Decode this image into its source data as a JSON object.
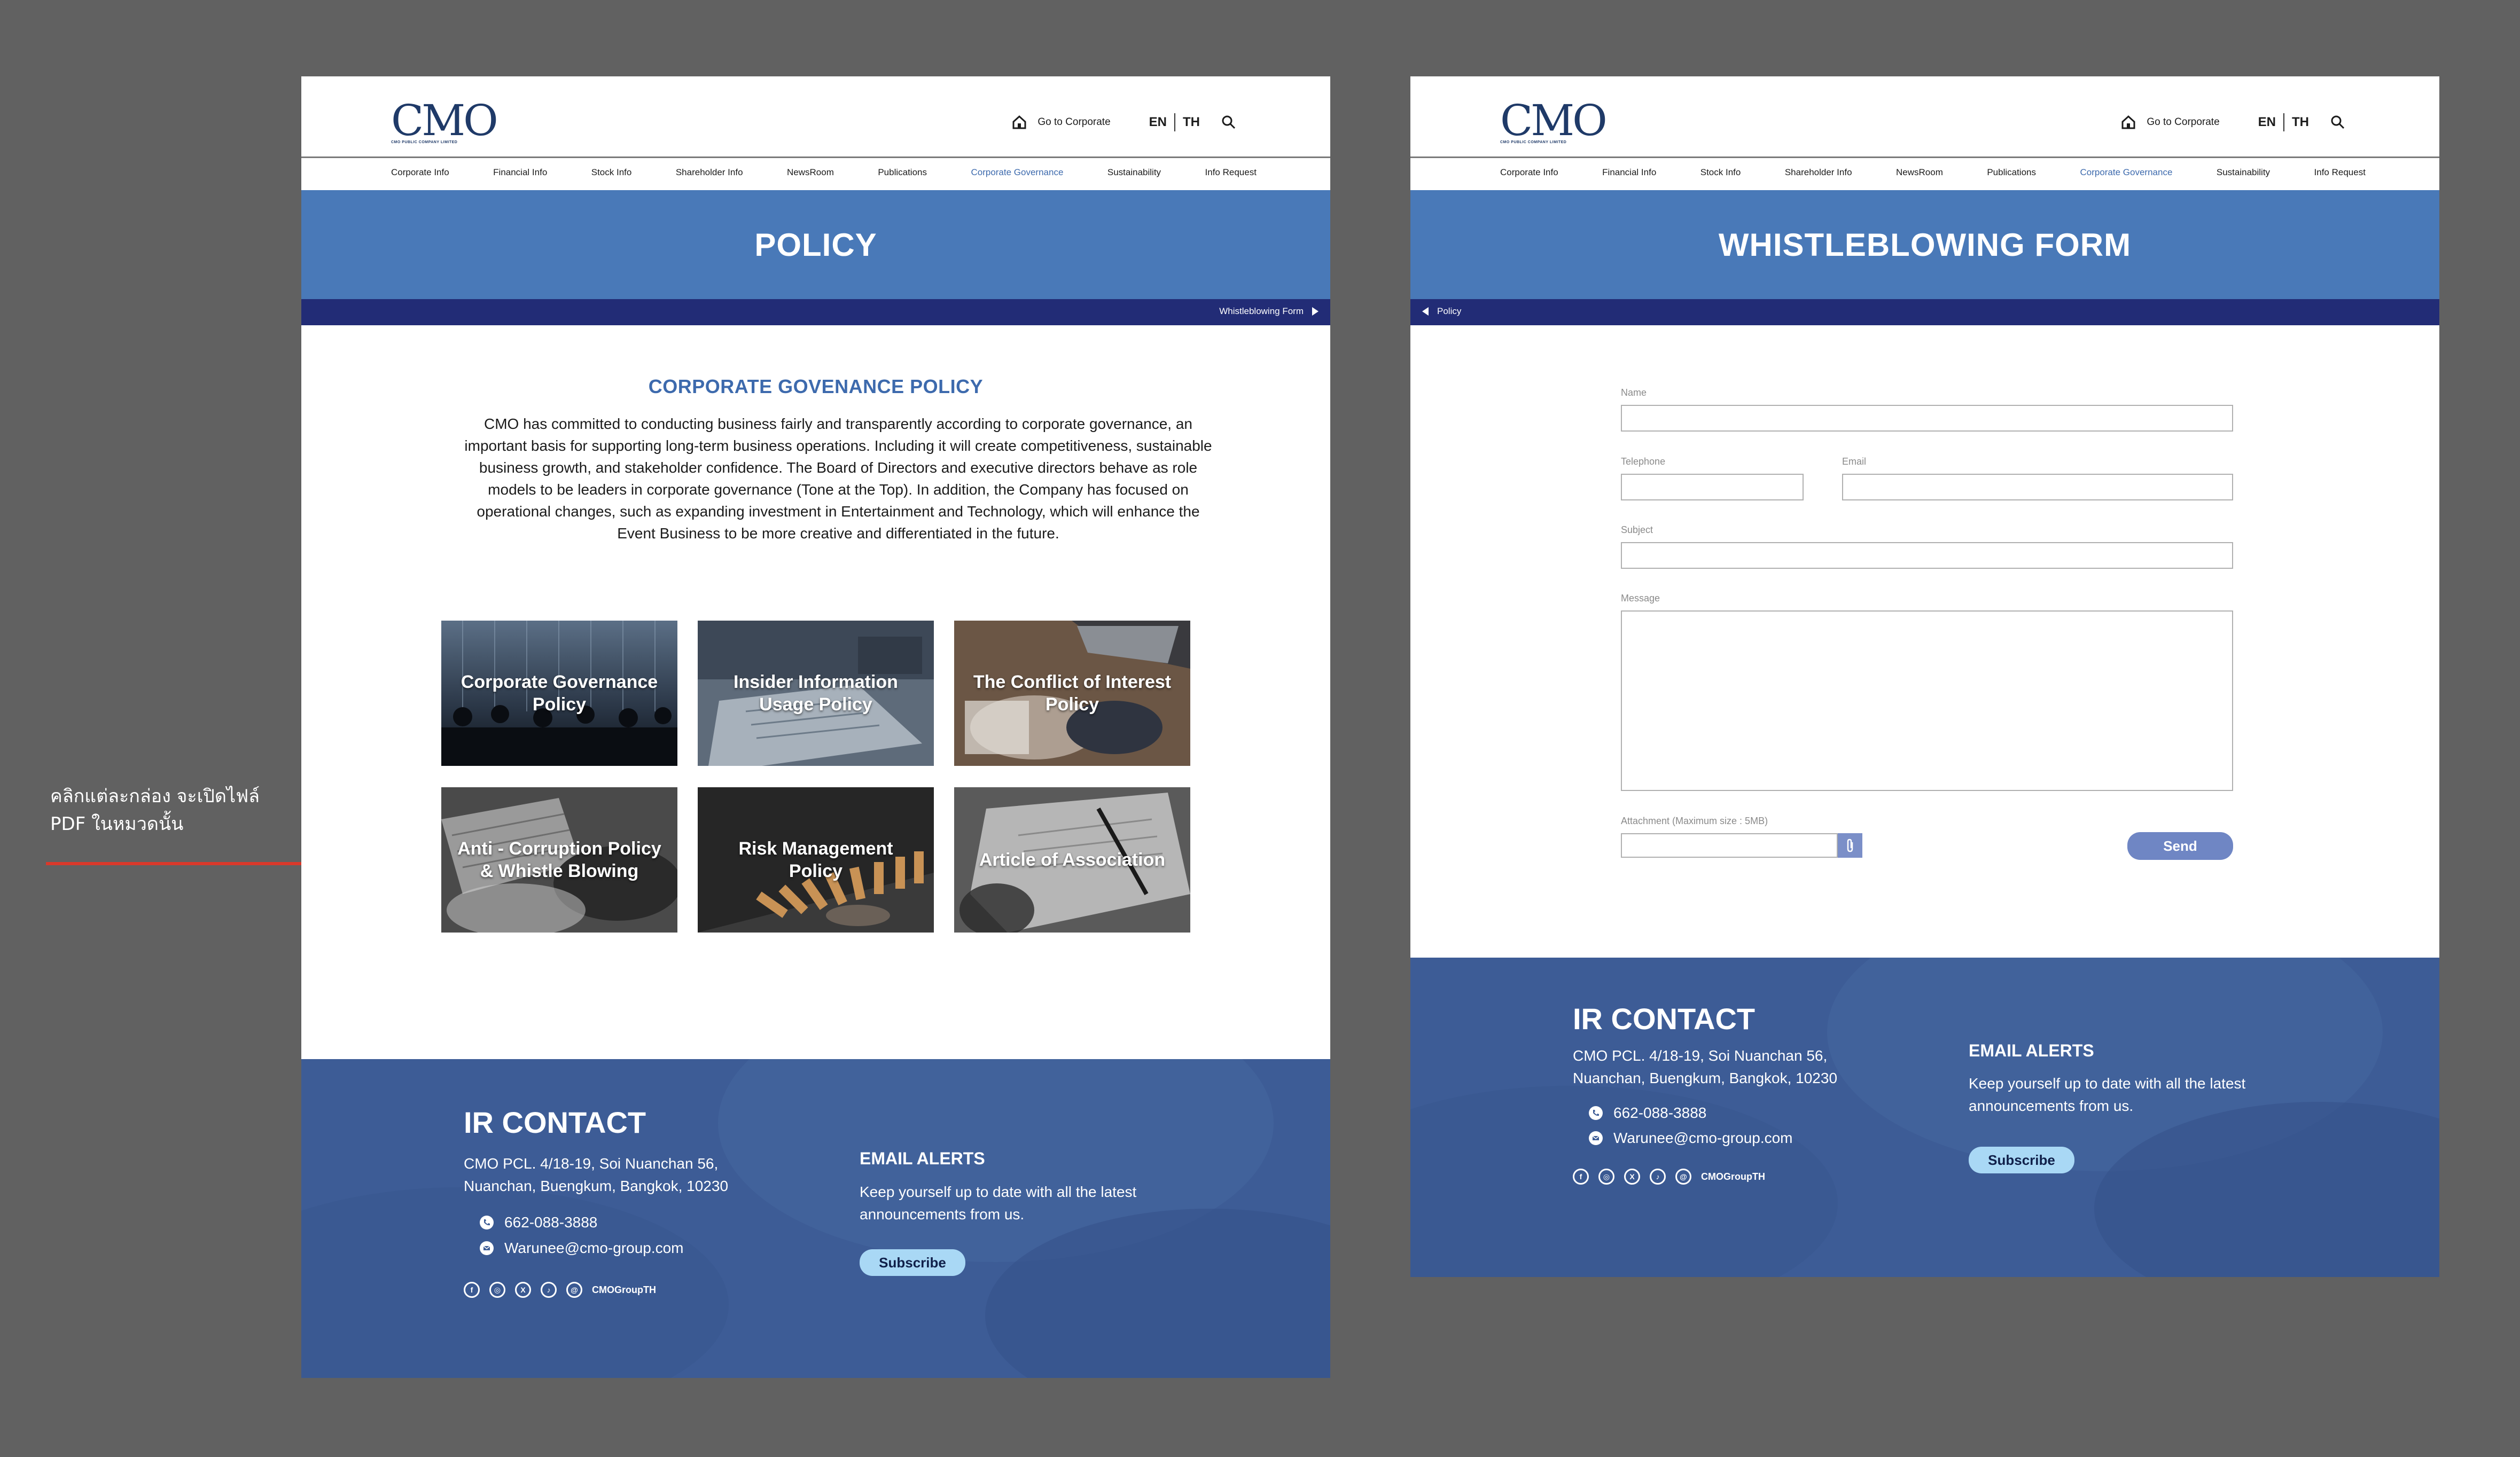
{
  "colors": {
    "canvas": "#616161",
    "banner": "#4979b8",
    "subbar": "#222c76",
    "accent": "#3d6aad",
    "footer": "#3d5c96",
    "subscribe": "#a9d8f5",
    "send": "#6f86c4",
    "arrow": "#d9392b"
  },
  "annotation": {
    "line1": "คลิกแต่ละกล่อง จะเปิดไฟล์",
    "line2": "PDF ในหมวดนั้น"
  },
  "header": {
    "logo_text": "CMO",
    "logo_sub": "CMO PUBLIC COMPANY LIMITED",
    "goto_label": "Go to Corporate",
    "lang_en": "EN",
    "lang_th": "TH",
    "icons": [
      "home-icon",
      "search-icon"
    ]
  },
  "nav": {
    "items": [
      "Corporate Info",
      "Financial Info",
      "Stock Info",
      "Shareholder Info",
      "NewsRoom",
      "Publications",
      "Corporate Governance",
      "Sustainability",
      "Info Request"
    ],
    "active": "Corporate Governance"
  },
  "policy": {
    "title": "POLICY",
    "next_link": "Whistleblowing Form",
    "section_title": "CORPORATE GOVENANCE POLICY",
    "intro": "CMO has committed to conducting business fairly and transparently according to corporate governance, an important basis for supporting long-term business operations. Including it will create competitiveness, sustainable business growth, and stakeholder confidence. The Board of Directors and executive directors behave as role models to be leaders in corporate governance (Tone at the Top). In addition, the Company has focused on operational changes, such as expanding investment in Entertainment and Technology, which will enhance the Event Business to be more creative and differentiated in the future.",
    "tiles": [
      {
        "label": "Corporate Governance Policy"
      },
      {
        "label": "Insider Information Usage Policy"
      },
      {
        "label": "The Conflict of Interest Policy"
      },
      {
        "label": "Anti - Corruption Policy & Whistle Blowing"
      },
      {
        "label": "Risk Management Policy"
      },
      {
        "label": "Article of Association"
      }
    ]
  },
  "form": {
    "title": "WHISTLEBLOWING FORM",
    "back_link": "Policy",
    "name_label": "Name",
    "telephone_label": "Telephone",
    "email_label": "Email",
    "subject_label": "Subject",
    "message_label": "Message",
    "attachment_label": "Attachment (Maximum size : 5MB)",
    "send_label": "Send"
  },
  "footer": {
    "ir_title": "IR CONTACT",
    "address_line1": "CMO PCL. 4/18-19, Soi Nuanchan 56,",
    "address_line2": "Nuanchan, Buengkum, Bangkok, 10230",
    "phone": "662-088-3888",
    "email": "Warunee@cmo-group.com",
    "social_handle": "CMOGroupTH",
    "social_icons": [
      "facebook-icon",
      "instagram-icon",
      "x-icon",
      "tiktok-icon",
      "threads-icon"
    ],
    "alerts_title": "EMAIL ALERTS",
    "alerts_text_line1": "Keep yourself up to date with all the latest",
    "alerts_text_line2": "announcements from us.",
    "subscribe_label": "Subscribe"
  }
}
